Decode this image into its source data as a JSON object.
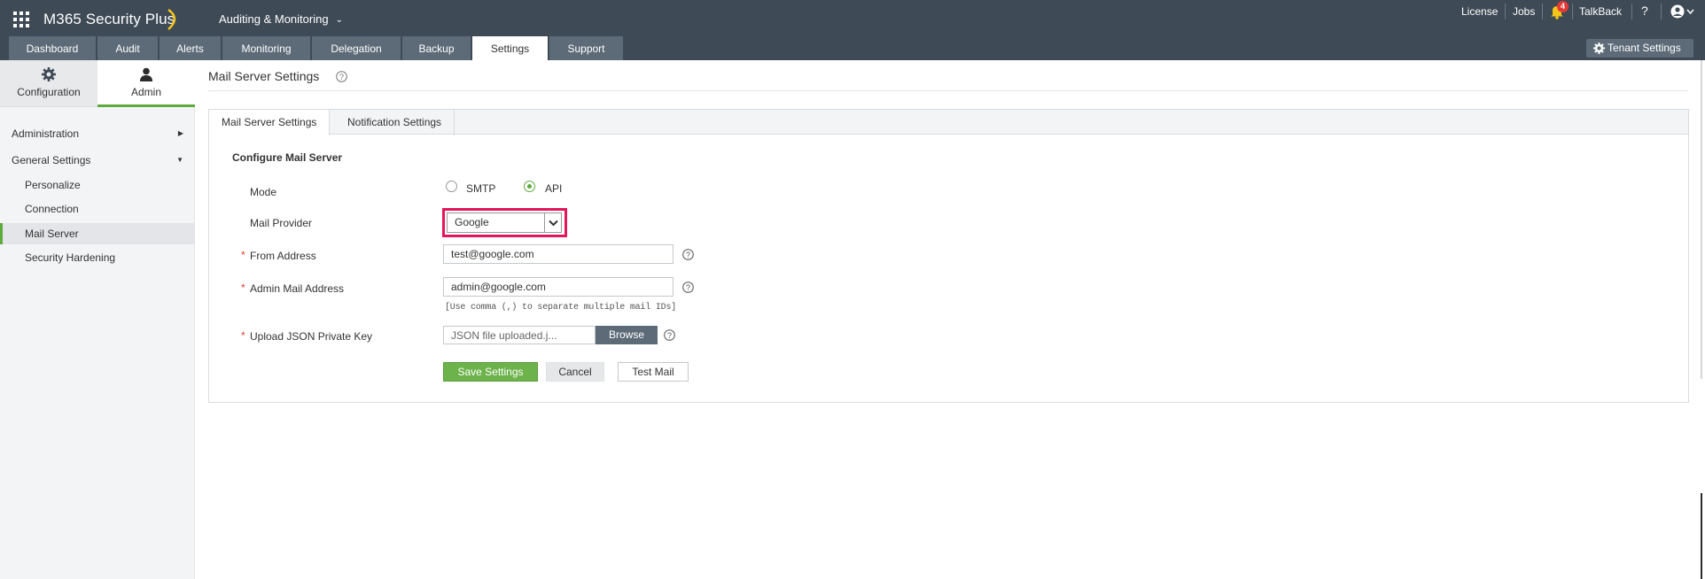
{
  "app": {
    "title": "M365 Security Plus",
    "module_menu": "Auditing & Monitoring",
    "module_chevron": "⌄"
  },
  "header_links": {
    "license": "License",
    "jobs": "Jobs",
    "notification_count": "4",
    "talkback": "TalkBack",
    "help": "?",
    "icons": [
      "apps-grid-icon",
      "bell-icon",
      "user-icon"
    ]
  },
  "nav": {
    "tabs": [
      {
        "label": "Dashboard"
      },
      {
        "label": "Audit"
      },
      {
        "label": "Alerts"
      },
      {
        "label": "Monitoring"
      },
      {
        "label": "Delegation"
      },
      {
        "label": "Backup"
      },
      {
        "label": "Settings",
        "active": true
      },
      {
        "label": "Support"
      }
    ],
    "tenant_settings": "Tenant Settings"
  },
  "sidebar": {
    "tabs": {
      "configuration": "Configuration",
      "admin": "Admin"
    },
    "items": [
      {
        "label": "Administration",
        "arrow": "▶"
      },
      {
        "label": "General Settings",
        "arrow": "▼"
      },
      {
        "label": "Personalize"
      },
      {
        "label": "Connection"
      },
      {
        "label": "Mail Server",
        "selected": true
      },
      {
        "label": "Security Hardening"
      }
    ]
  },
  "main": {
    "title": "Mail Server Settings",
    "panel_tabs": [
      "Mail Server Settings",
      "Notification Settings"
    ],
    "section_title": "Configure Mail Server",
    "mode": {
      "label": "Mode",
      "options": [
        "SMTP",
        "API"
      ],
      "selected": "API"
    },
    "mail_provider": {
      "label": "Mail Provider",
      "value": "Google"
    },
    "from_address": {
      "label": "From Address",
      "value": "test@google.com",
      "required": "*"
    },
    "admin_mail": {
      "label": "Admin Mail Address",
      "value": "admin@google.com",
      "required": "*",
      "hint": "[Use comma (,) to separate multiple mail IDs]"
    },
    "json_key": {
      "label": "Upload JSON Private Key",
      "value": "JSON file uploaded.j...",
      "required": "*",
      "browse": "Browse"
    },
    "buttons": {
      "save": "Save Settings",
      "cancel": "Cancel",
      "test": "Test Mail"
    }
  },
  "colors": {
    "topbar": "#3e4a56",
    "tab": "#5d6b78",
    "accent_green": "#6db34b",
    "highlight": "#e3155c",
    "required": "#e03c31"
  }
}
